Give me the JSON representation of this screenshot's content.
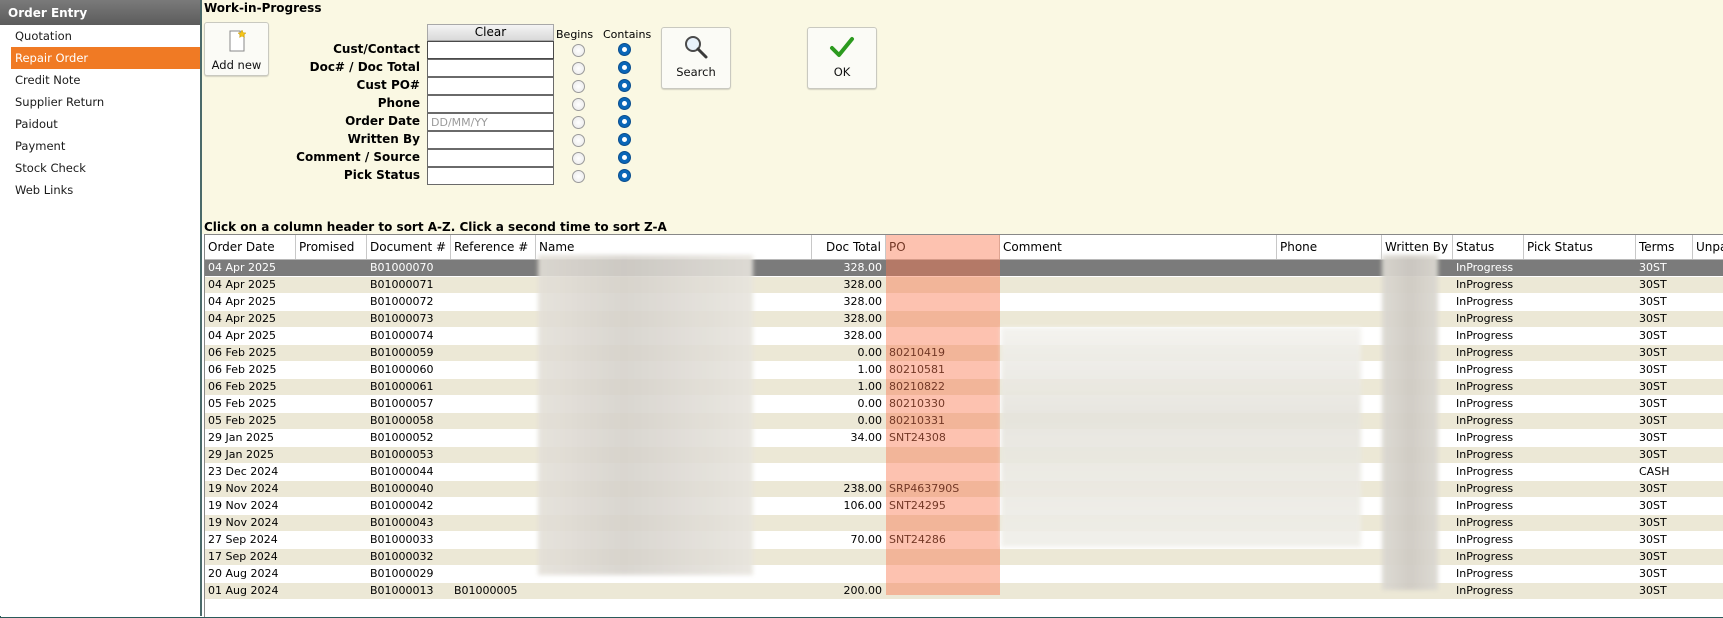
{
  "sidebar": {
    "title": "Order Entry",
    "items": [
      {
        "label": "Quotation"
      },
      {
        "label": "Repair Order"
      },
      {
        "label": "Credit Note"
      },
      {
        "label": "Supplier Return"
      },
      {
        "label": "Paidout"
      },
      {
        "label": "Payment"
      },
      {
        "label": "Stock Check"
      },
      {
        "label": "Web Links"
      }
    ],
    "active_item": "Repair Order"
  },
  "search": {
    "title": "Work-in-Progress",
    "add_new_label": "Add new",
    "clear_label": "Clear",
    "begins_label": "Begins",
    "contains_label": "Contains",
    "search_label": "Search",
    "ok_label": "OK",
    "fields": [
      {
        "label": "Cust/Contact",
        "value": "",
        "placeholder": "",
        "match": "contains"
      },
      {
        "label": "Doc# / Doc Total",
        "value": "",
        "placeholder": "",
        "match": "contains"
      },
      {
        "label": "Cust PO#",
        "value": "",
        "placeholder": "",
        "match": "contains"
      },
      {
        "label": "Phone",
        "value": "",
        "placeholder": "",
        "match": "contains"
      },
      {
        "label": "Order Date",
        "value": "",
        "placeholder": "DD/MM/YY",
        "match": "contains"
      },
      {
        "label": "Written By",
        "value": "",
        "placeholder": "",
        "match": "contains"
      },
      {
        "label": "Comment / Source",
        "value": "",
        "placeholder": "",
        "match": "contains"
      },
      {
        "label": "Pick Status",
        "value": "",
        "placeholder": "",
        "match": "contains"
      }
    ]
  },
  "grid": {
    "hint": "Click on a column header to sort A-Z.  Click a second time to sort Z-A",
    "columns": [
      "Order Date",
      "Promised",
      "Document #",
      "Reference #",
      "Name",
      "Doc Total",
      "PO",
      "Comment",
      "Phone",
      "Written By",
      "Status",
      "Pick Status",
      "Terms",
      "Unpa"
    ],
    "rows": [
      {
        "order_date": "04 Apr 2025",
        "promised": "",
        "document": "B01000070",
        "reference": "",
        "doc_total": "328.00",
        "po": "",
        "status": "InProgress",
        "pick_status": "",
        "terms": "30ST"
      },
      {
        "order_date": "04 Apr 2025",
        "promised": "",
        "document": "B01000071",
        "reference": "",
        "doc_total": "328.00",
        "po": "",
        "status": "InProgress",
        "pick_status": "",
        "terms": "30ST"
      },
      {
        "order_date": "04 Apr 2025",
        "promised": "",
        "document": "B01000072",
        "reference": "",
        "doc_total": "328.00",
        "po": "",
        "status": "InProgress",
        "pick_status": "",
        "terms": "30ST"
      },
      {
        "order_date": "04 Apr 2025",
        "promised": "",
        "document": "B01000073",
        "reference": "",
        "doc_total": "328.00",
        "po": "",
        "status": "InProgress",
        "pick_status": "",
        "terms": "30ST"
      },
      {
        "order_date": "04 Apr 2025",
        "promised": "",
        "document": "B01000074",
        "reference": "",
        "doc_total": "328.00",
        "po": "",
        "status": "InProgress",
        "pick_status": "",
        "terms": "30ST"
      },
      {
        "order_date": "06 Feb 2025",
        "promised": "",
        "document": "B01000059",
        "reference": "",
        "doc_total": "0.00",
        "po": "80210419",
        "status": "InProgress",
        "pick_status": "",
        "terms": "30ST"
      },
      {
        "order_date": "06 Feb 2025",
        "promised": "",
        "document": "B01000060",
        "reference": "",
        "doc_total": "1.00",
        "po": "80210581",
        "status": "InProgress",
        "pick_status": "",
        "terms": "30ST"
      },
      {
        "order_date": "06 Feb 2025",
        "promised": "",
        "document": "B01000061",
        "reference": "",
        "doc_total": "1.00",
        "po": "80210822",
        "status": "InProgress",
        "pick_status": "",
        "terms": "30ST"
      },
      {
        "order_date": "05 Feb 2025",
        "promised": "",
        "document": "B01000057",
        "reference": "",
        "doc_total": "0.00",
        "po": "80210330",
        "status": "InProgress",
        "pick_status": "",
        "terms": "30ST"
      },
      {
        "order_date": "05 Feb 2025",
        "promised": "",
        "document": "B01000058",
        "reference": "",
        "doc_total": "0.00",
        "po": "80210331",
        "status": "InProgress",
        "pick_status": "",
        "terms": "30ST"
      },
      {
        "order_date": "29 Jan 2025",
        "promised": "",
        "document": "B01000052",
        "reference": "",
        "doc_total": "34.00",
        "po": "SNT24308",
        "status": "InProgress",
        "pick_status": "",
        "terms": "30ST"
      },
      {
        "order_date": "29 Jan 2025",
        "promised": "",
        "document": "B01000053",
        "reference": "",
        "doc_total": "",
        "po": "",
        "status": "InProgress",
        "pick_status": "",
        "terms": "30ST"
      },
      {
        "order_date": "23 Dec 2024",
        "promised": "",
        "document": "B01000044",
        "reference": "",
        "doc_total": "",
        "po": "",
        "status": "InProgress",
        "pick_status": "",
        "terms": "CASH"
      },
      {
        "order_date": "19 Nov 2024",
        "promised": "",
        "document": "B01000040",
        "reference": "",
        "doc_total": "238.00",
        "po": "SRP463790S",
        "status": "InProgress",
        "pick_status": "",
        "terms": "30ST"
      },
      {
        "order_date": "19 Nov 2024",
        "promised": "",
        "document": "B01000042",
        "reference": "",
        "doc_total": "106.00",
        "po": "SNT24295",
        "status": "InProgress",
        "pick_status": "",
        "terms": "30ST"
      },
      {
        "order_date": "19 Nov 2024",
        "promised": "",
        "document": "B01000043",
        "reference": "",
        "doc_total": "",
        "po": "",
        "status": "InProgress",
        "pick_status": "",
        "terms": "30ST"
      },
      {
        "order_date": "27 Sep 2024",
        "promised": "",
        "document": "B01000033",
        "reference": "",
        "doc_total": "70.00",
        "po": "SNT24286",
        "status": "InProgress",
        "pick_status": "",
        "terms": "30ST"
      },
      {
        "order_date": "17 Sep 2024",
        "promised": "",
        "document": "B01000032",
        "reference": "",
        "doc_total": "",
        "po": "",
        "status": "InProgress",
        "pick_status": "",
        "terms": "30ST"
      },
      {
        "order_date": "20 Aug 2024",
        "promised": "",
        "document": "B01000029",
        "reference": "",
        "doc_total": "",
        "po": "",
        "status": "InProgress",
        "pick_status": "",
        "terms": "30ST"
      },
      {
        "order_date": "01 Aug 2024",
        "promised": "",
        "document": "B01000013",
        "reference": "B01000005",
        "doc_total": "200.00",
        "po": "",
        "status": "InProgress",
        "pick_status": "",
        "terms": "30ST"
      }
    ],
    "selected_row": 0
  },
  "colors": {
    "active_item": "#f07a24",
    "po_highlight": "#fa7850",
    "search_background": "#faf8e3",
    "selected_row": "#7b7b7b",
    "radio_selected": "#0a66b8"
  },
  "icons": {
    "add_new": "document-star-icon",
    "search": "magnifier-icon",
    "ok": "checkmark-icon"
  }
}
